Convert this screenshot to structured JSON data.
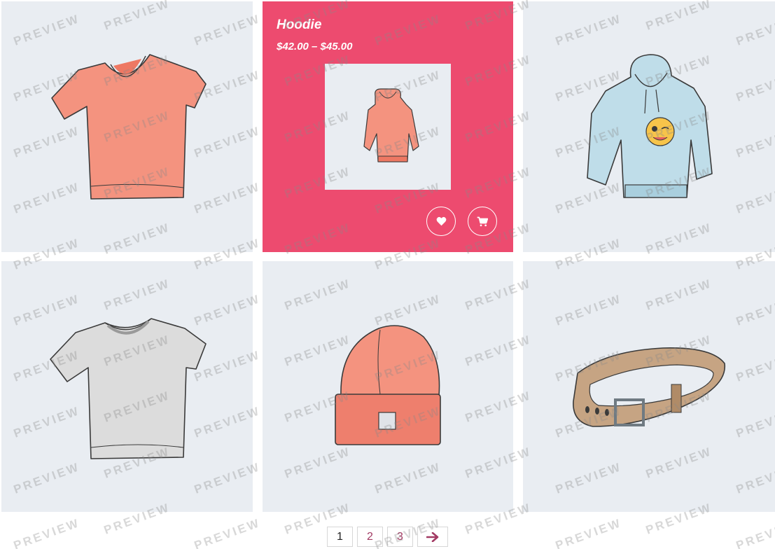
{
  "products": {
    "hovered": {
      "title": "Hoodie",
      "price": "$42.00 – $45.00",
      "wishlist_icon": "heart-icon",
      "cart_icon": "cart-icon"
    },
    "tiles": [
      {
        "image": "v-neck-tshirt-pink"
      },
      {
        "image": "hoodie-pink"
      },
      {
        "image": "hoodie-blue-emoji"
      },
      {
        "image": "tshirt-gray"
      },
      {
        "image": "beanie-pink"
      },
      {
        "image": "belt-brown"
      }
    ]
  },
  "pagination": {
    "pages": [
      "1",
      "2",
      "3"
    ],
    "current": "1",
    "next_icon": "arrow-right-icon"
  },
  "watermark": {
    "text": "PREVIEW"
  },
  "colors": {
    "tile_bg": "#e9edf2",
    "hover_bg": "#ed4b6f",
    "link": "#a23a63"
  }
}
